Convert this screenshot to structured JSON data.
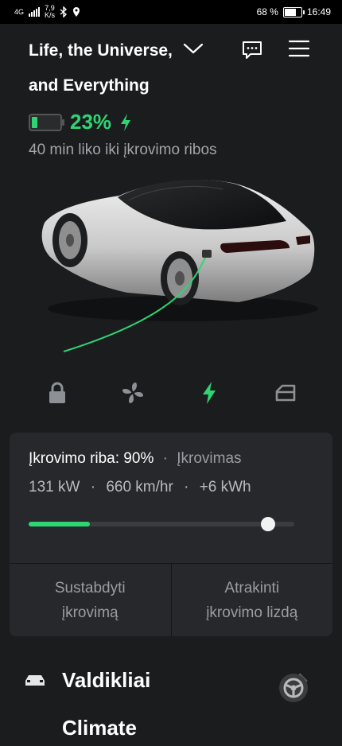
{
  "status_bar": {
    "network": "4G",
    "speed_value": "7,9",
    "speed_unit": "K/s",
    "battery": "68 %",
    "time": "16:49"
  },
  "header": {
    "title_line1": "Life, the Universe,",
    "title_line2": "and Everything",
    "chevron_icon": "chevron-down-icon",
    "message_icon": "chat-bubble-icon",
    "menu_icon": "hamburger-menu-icon"
  },
  "charge": {
    "percent": "23%",
    "level": 0.23,
    "status_text": "40 min liko iki įkrovimo ribos",
    "accent_color": "#2ed573"
  },
  "quick_controls": {
    "items": [
      "lock-icon",
      "fan-icon",
      "charging-bolt-icon",
      "frunk-icon"
    ],
    "active": "charging-bolt-icon"
  },
  "charging_panel": {
    "limit_label": "Įkrovimo riba: 90%",
    "separator": "·",
    "state": "Įkrovimas",
    "power": "131 kW",
    "rate": "660 km/hr",
    "energy": "+6 kWh",
    "current_level": 0.23,
    "limit_level": 0.9,
    "stop_button": "Sustabdyti\nįkrovimą",
    "unlock_button": "Atrakinti\nįkrovimo lizdą"
  },
  "sections": {
    "controls_label": "Valdikliai",
    "climate_label": "Climate"
  }
}
